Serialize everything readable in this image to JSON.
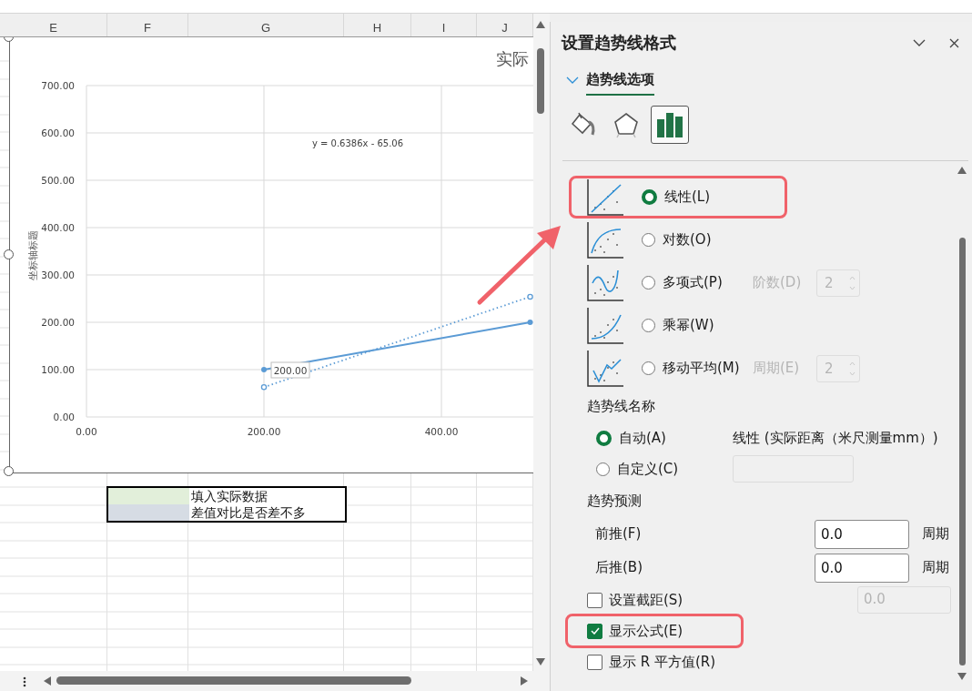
{
  "sheet": {
    "columns": [
      "E",
      "F",
      "G",
      "H",
      "I",
      "J"
    ],
    "legend": [
      {
        "color": "#e2efda",
        "text": "填入实际数据"
      },
      {
        "color": "#d6dce4",
        "text": "差值对比是否差不多"
      }
    ],
    "chart": {
      "selected": true,
      "chart_data": {
        "type": "line",
        "title": "实际",
        "ylabel": "坐标轴标题",
        "x": [
          200,
          500
        ],
        "series": [
          {
            "color": "#5b9bd5",
            "values": [
              100,
              200
            ],
            "marker": "circle"
          },
          {
            "color": "#5b9bd5",
            "values": [
              63,
              254
            ],
            "marker": "circle",
            "line_style": "dotted"
          }
        ],
        "grid": true,
        "xlim": [
          0,
          505
        ],
        "ylim": [
          0,
          700
        ],
        "xticks": [
          {
            "value": 0,
            "label": "0.00"
          },
          {
            "value": 200,
            "label": "200.00"
          },
          {
            "value": 400,
            "label": "400.00"
          }
        ],
        "yticks": [
          {
            "value": 0,
            "label": "0.00"
          },
          {
            "value": 100,
            "label": "100.00"
          },
          {
            "value": 200,
            "label": "200.00"
          },
          {
            "value": 300,
            "label": "300.00"
          },
          {
            "value": 400,
            "label": "400.00"
          },
          {
            "value": 500,
            "label": "500.00"
          },
          {
            "value": 600,
            "label": "600.00"
          },
          {
            "value": 700,
            "label": "700.00"
          }
        ],
        "annotations": [
          "y = 0.6386x - 65.06",
          {
            "text": "200.00",
            "x": 200,
            "y": 100
          }
        ]
      }
    }
  },
  "panel": {
    "title": "设置趋势线格式",
    "section": {
      "label": "趋势线选项",
      "expanded": true
    },
    "icon_tabs": [
      {
        "kind": "fill",
        "selected": false
      },
      {
        "kind": "effects",
        "selected": false
      },
      {
        "kind": "options",
        "selected": true
      }
    ],
    "trend_types": [
      {
        "kind": "linear",
        "label": "线性(L)",
        "selected": true,
        "highlighted": true
      },
      {
        "kind": "logarithmic",
        "label": "对数(O)",
        "selected": false,
        "highlighted": false
      },
      {
        "kind": "polynomial",
        "label": "多项式(P)",
        "selected": false,
        "highlighted": false,
        "param": {
          "label": "阶数(D)",
          "value": "2",
          "disabled": true
        }
      },
      {
        "kind": "power",
        "label": "乘幂(W)",
        "selected": false,
        "highlighted": false
      },
      {
        "kind": "moving_average",
        "label": "移动平均(M)",
        "selected": false,
        "highlighted": false,
        "param": {
          "label": "周期(E)",
          "value": "2",
          "disabled": true
        }
      }
    ],
    "name_heading": "趋势线名称",
    "name_options": [
      {
        "kind": "auto",
        "label": "自动(A)",
        "selected": true,
        "value": "线性 (实际距离（米尺测量mm）)"
      },
      {
        "kind": "custom",
        "label": "自定义(C)",
        "selected": false,
        "disabled": true
      }
    ],
    "forecast": {
      "heading": "趋势预测",
      "rows": [
        {
          "label": "前推(F)",
          "value": "0.0",
          "unit": "周期"
        },
        {
          "label": "后推(B)",
          "value": "0.0",
          "unit": "周期"
        }
      ]
    },
    "checkboxes": [
      {
        "label": "设置截距(S)",
        "checked": false,
        "highlighted": false,
        "field": {
          "value": "0.0",
          "disabled": true
        }
      },
      {
        "label": "显示公式(E)",
        "checked": true,
        "highlighted": true
      },
      {
        "label": "显示 R 平方值(R)",
        "checked": false,
        "highlighted": false
      }
    ]
  }
}
